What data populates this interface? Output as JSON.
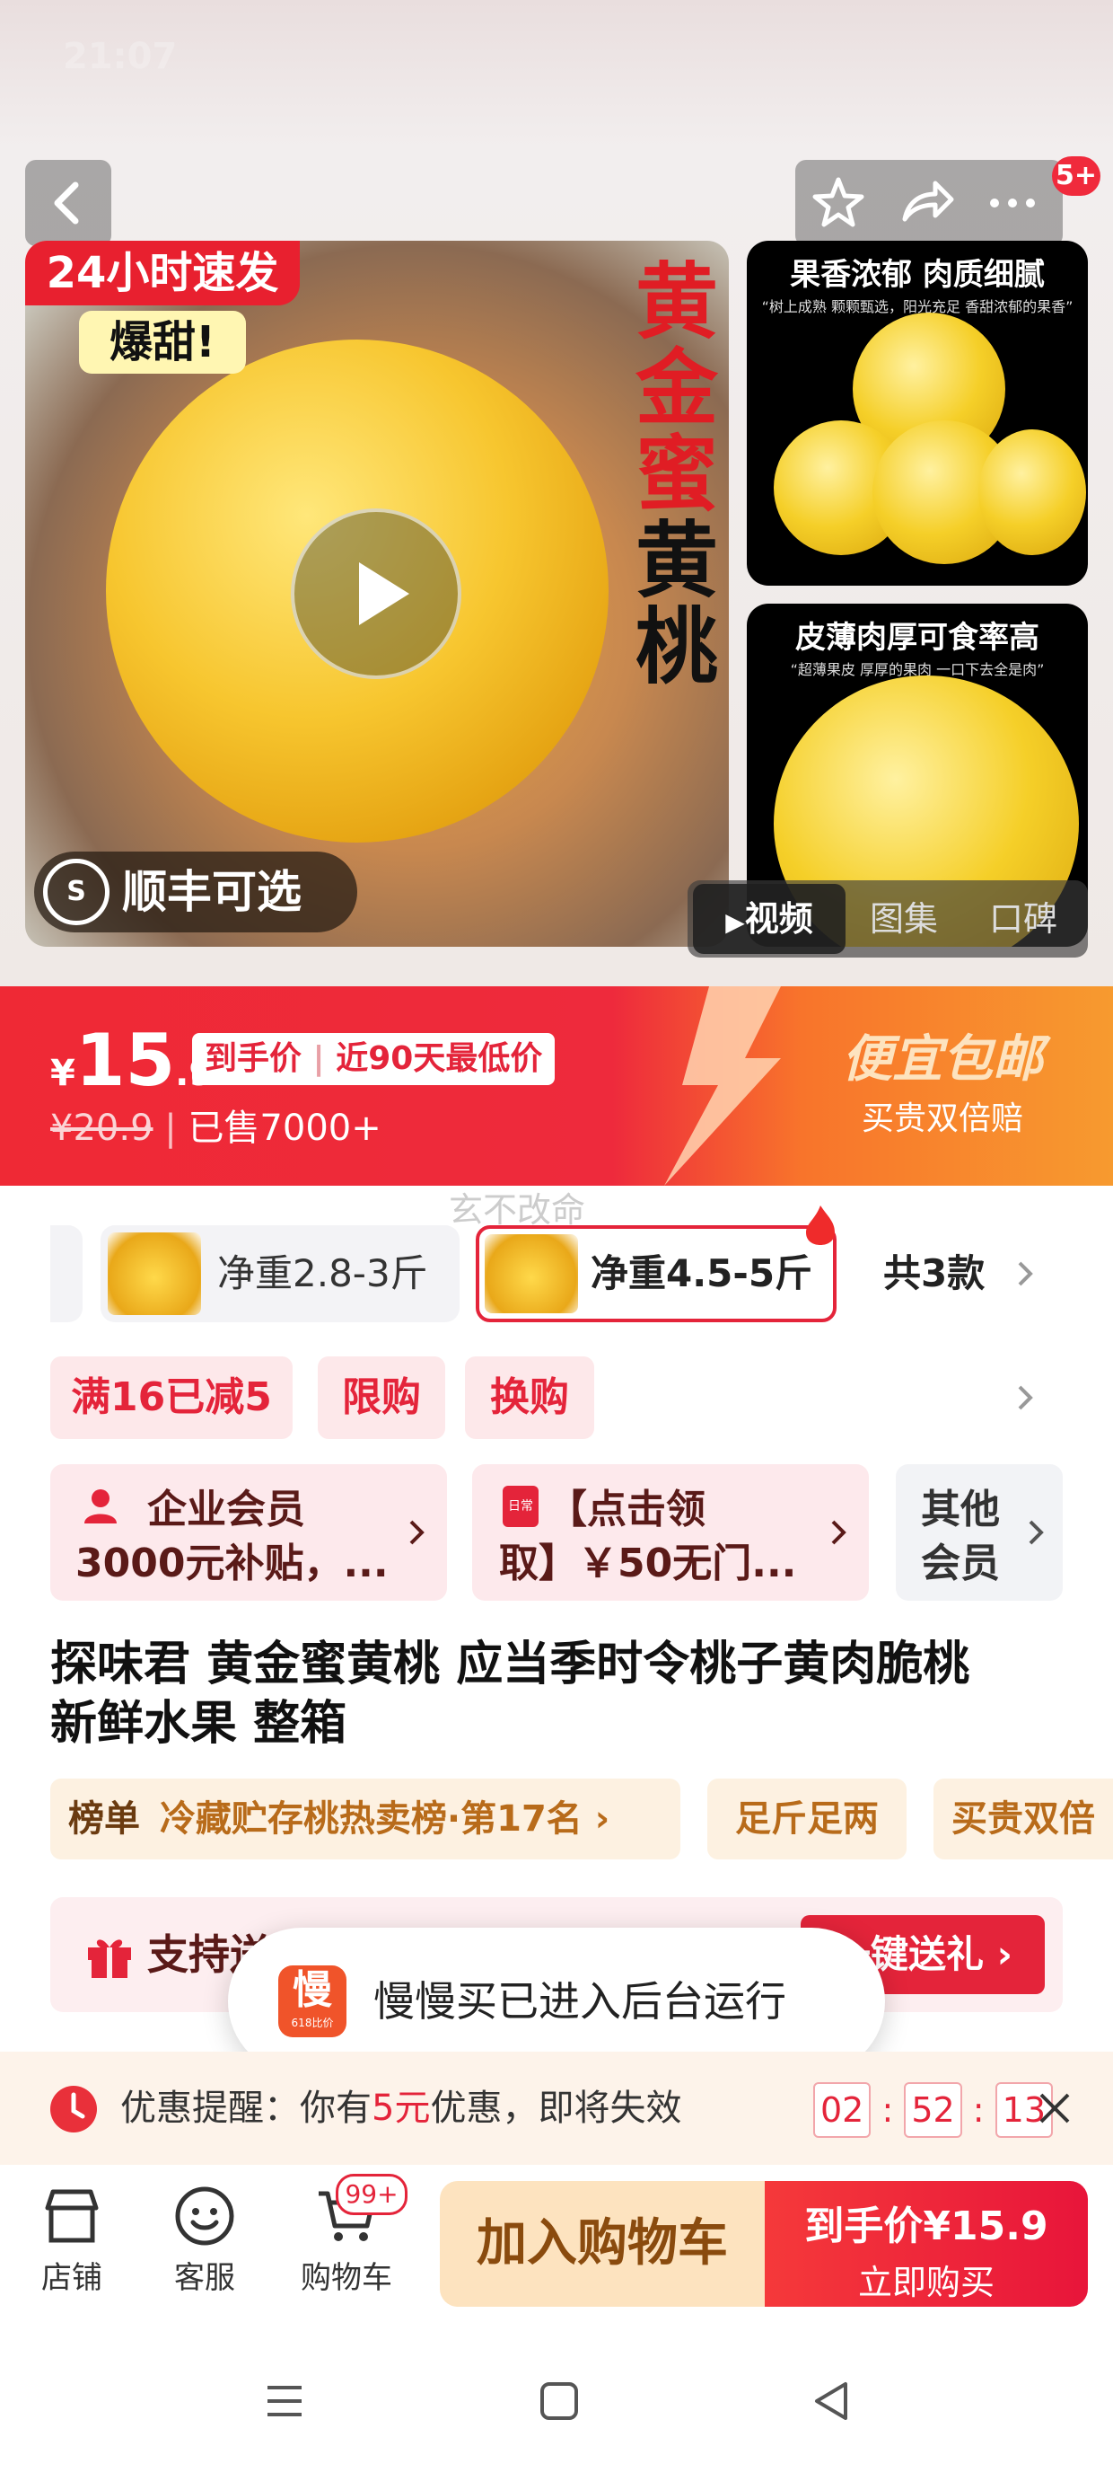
{
  "status": {
    "time": "21:07"
  },
  "gallery": {
    "badge": "5+",
    "main_banner_line1": "24小时速发",
    "main_banner_line2": "爆甜!",
    "vertical_title": [
      "黄",
      "金",
      "蜜",
      "黄",
      "桃"
    ],
    "sf_badge": "顺丰可选",
    "side1_title": "果香浓郁 肉质细腻",
    "side1_sub": "“树上成熟 颗颗甄选，阳光充足 香甜浓郁的果香”",
    "side2_title": "皮薄肉厚可食率高",
    "side2_sub": "“超薄果皮 厚厚的果肉 一口下去全是肉”",
    "tabs": [
      "视频",
      "图集",
      "口碑"
    ]
  },
  "price": {
    "currency": "¥",
    "main": "15",
    "decimal": ".9",
    "tag1": "到手价",
    "tag2": "近90天最低价",
    "original": "¥20.9",
    "sold": "已售7000+",
    "promo_title": "便宜包邮",
    "promo_sub": "买贵双倍赔"
  },
  "watermark": "玄不改命",
  "sku": {
    "opt1": "净重2.8-3斤",
    "opt2": "净重4.5-5斤",
    "total": "共3款"
  },
  "promo_tags": [
    "满16已减5",
    "限购",
    "换购"
  ],
  "benefits": {
    "card1": "企业会员3000元补贴，...",
    "card1_line1": "企业会员",
    "card1_line2": "3000元补贴，...",
    "card2_line1": "【点击领",
    "card2_line2": "取】￥50无门...",
    "card3_line1": "其他",
    "card3_line2": "会员"
  },
  "product": {
    "title_line1": "探味君 黄金蜜黄桃 应当季时令桃子黄肉脆桃",
    "title_line2": "新鲜水果 整箱",
    "rank_label": "榜单",
    "rank_text": "冷藏贮存桃热卖榜·第17名",
    "pill2": "足斤足两",
    "pill3": "买贵双倍"
  },
  "gift": {
    "label": "支持送礼",
    "button": "一键送礼"
  },
  "toast": {
    "text": "慢慢买已进入后台运行",
    "logo_char": "慢",
    "logo_sub": "618比价"
  },
  "reminder": {
    "prefix": "优惠提醒：你有",
    "amount": "5元",
    "suffix": "优惠，即将失效",
    "h": "02",
    "m": "52",
    "s": "13"
  },
  "bottom": {
    "shop": "店铺",
    "service": "客服",
    "cart": "购物车",
    "cart_badge": "99+",
    "add_cart": "加入购物车",
    "buy_price_label": "到手价",
    "buy_price": "¥15.9",
    "buy_now": "立即购买"
  },
  "colors": {
    "accent": "#e4243a",
    "orange": "#f79a2f",
    "cream": "#fde3bf"
  }
}
